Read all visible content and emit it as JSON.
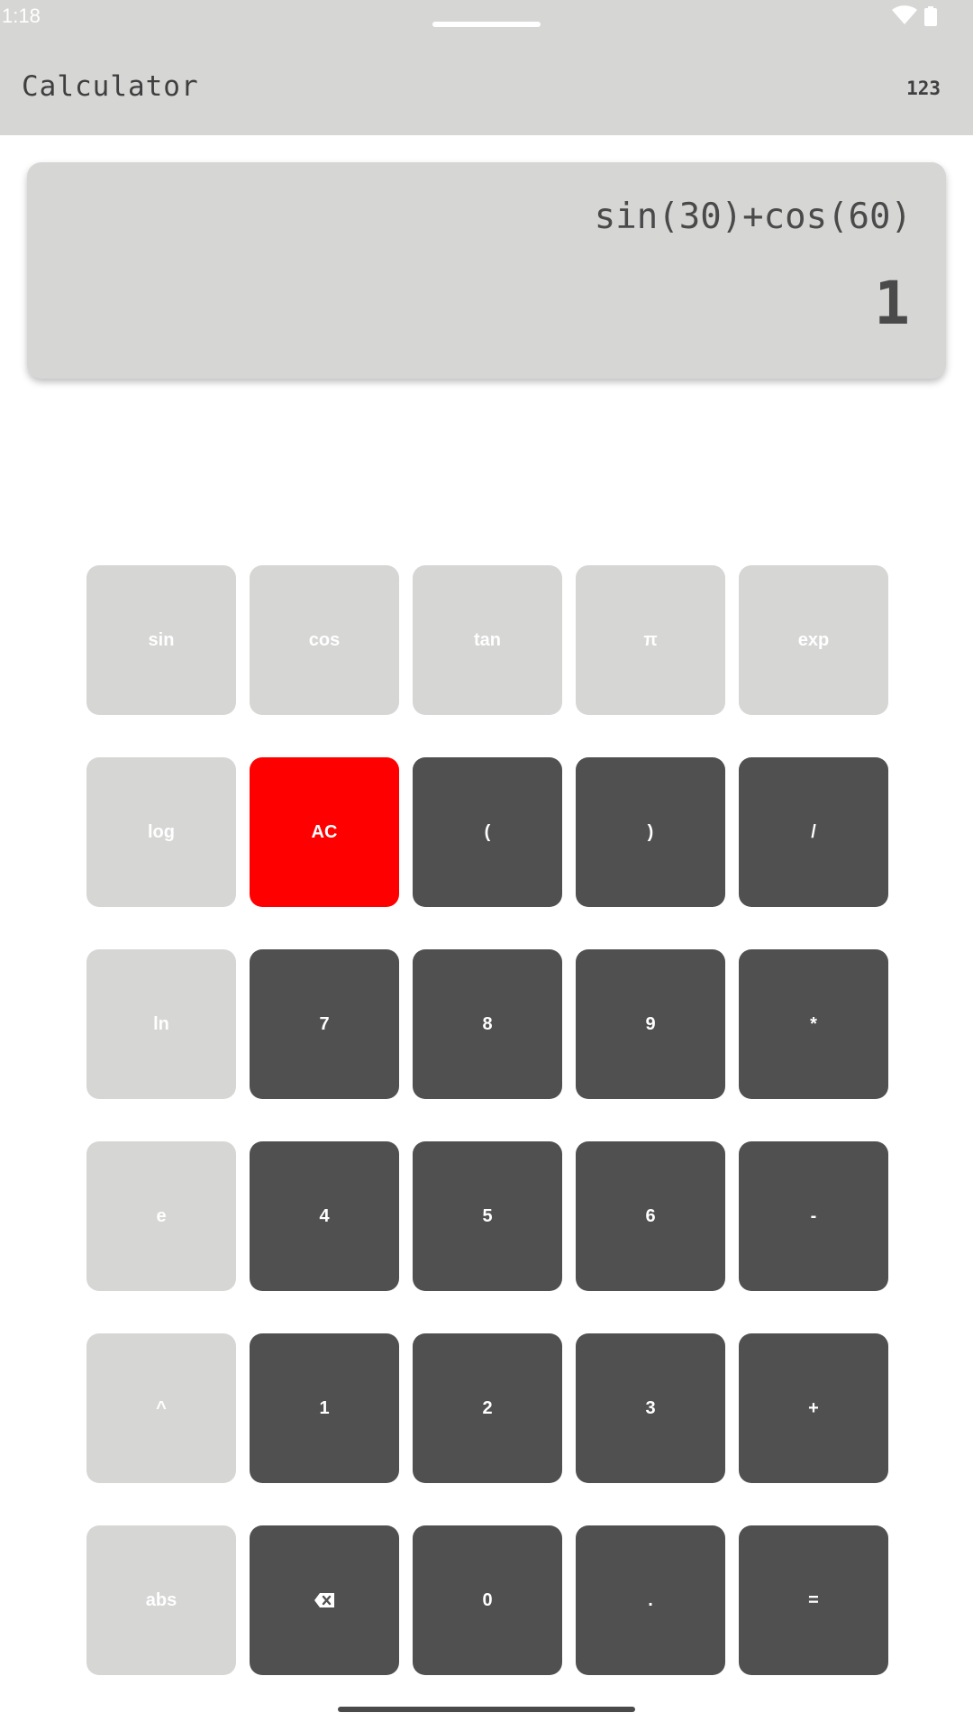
{
  "status_bar": {
    "time": "1:18",
    "wifi_icon": "wifi-icon",
    "battery_icon": "battery-icon"
  },
  "app_bar": {
    "title": "Calculator",
    "mode_toggle": "123"
  },
  "display": {
    "expression": "sin(30)+cos(60)",
    "result": "1"
  },
  "colors": {
    "function_key": "#d6d6d5",
    "number_key": "#505050",
    "clear_key": "#ff0000",
    "bar_background": "#d6d6d5"
  },
  "keypad": {
    "rows": [
      [
        {
          "label": "sin",
          "kind": "fn"
        },
        {
          "label": "cos",
          "kind": "fn"
        },
        {
          "label": "tan",
          "kind": "fn"
        },
        {
          "label": "π",
          "kind": "fn"
        },
        {
          "label": "exp",
          "kind": "fn"
        }
      ],
      [
        {
          "label": "log",
          "kind": "fn"
        },
        {
          "label": "AC",
          "kind": "clear"
        },
        {
          "label": "(",
          "kind": "num"
        },
        {
          "label": ")",
          "kind": "num"
        },
        {
          "label": "/",
          "kind": "num"
        }
      ],
      [
        {
          "label": "ln",
          "kind": "fn"
        },
        {
          "label": "7",
          "kind": "num"
        },
        {
          "label": "8",
          "kind": "num"
        },
        {
          "label": "9",
          "kind": "num"
        },
        {
          "label": "*",
          "kind": "num"
        }
      ],
      [
        {
          "label": "e",
          "kind": "fn"
        },
        {
          "label": "4",
          "kind": "num"
        },
        {
          "label": "5",
          "kind": "num"
        },
        {
          "label": "6",
          "kind": "num"
        },
        {
          "label": "-",
          "kind": "num"
        }
      ],
      [
        {
          "label": "^",
          "kind": "fn"
        },
        {
          "label": "1",
          "kind": "num"
        },
        {
          "label": "2",
          "kind": "num"
        },
        {
          "label": "3",
          "kind": "num"
        },
        {
          "label": "+",
          "kind": "num"
        }
      ],
      [
        {
          "label": "abs",
          "kind": "fn"
        },
        {
          "label": "",
          "kind": "num",
          "icon": "backspace-icon"
        },
        {
          "label": "0",
          "kind": "num"
        },
        {
          "label": ".",
          "kind": "num"
        },
        {
          "label": "=",
          "kind": "num"
        }
      ]
    ]
  }
}
